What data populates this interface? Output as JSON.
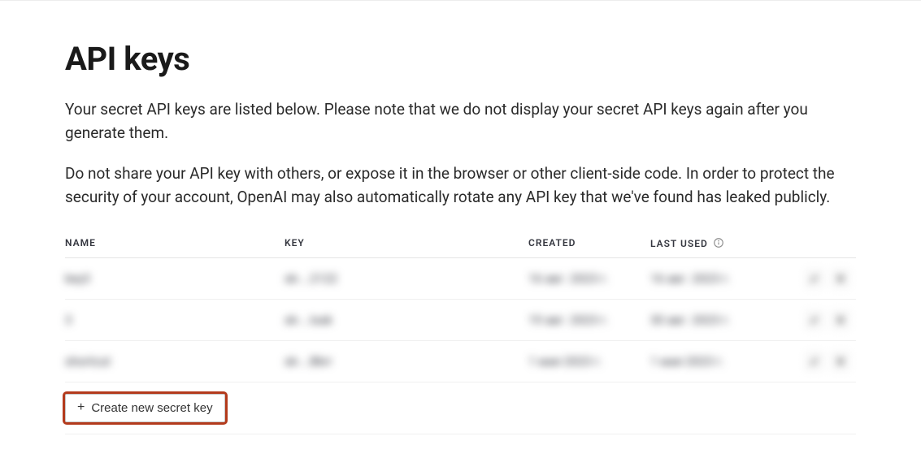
{
  "title": "API keys",
  "desc1": "Your secret API keys are listed below. Please note that we do not display your secret API keys again after you generate them.",
  "desc2": "Do not share your API key with others, or expose it in the browser or other client-side code. In order to protect the security of your account, OpenAI may also automatically rotate any API key that we've found has leaked publicly.",
  "columns": {
    "name": "NAME",
    "key": "KEY",
    "created": "CREATED",
    "last_used": "LAST USED"
  },
  "rows": [
    {
      "name": "key3",
      "key": "sk-...2122",
      "created": "16 авг. 2023 г.",
      "last_used": "16 авг. 2023 г."
    },
    {
      "name": "3",
      "key": "sk-...Isak",
      "created": "19 авг. 2023 г.",
      "last_used": "30 авг. 2023 г."
    },
    {
      "name": "shortcut",
      "key": "sk-...Bkrr",
      "created": "1 мая 2023 г.",
      "last_used": "1 мая 2023 г."
    }
  ],
  "create_label": "Create new secret key"
}
